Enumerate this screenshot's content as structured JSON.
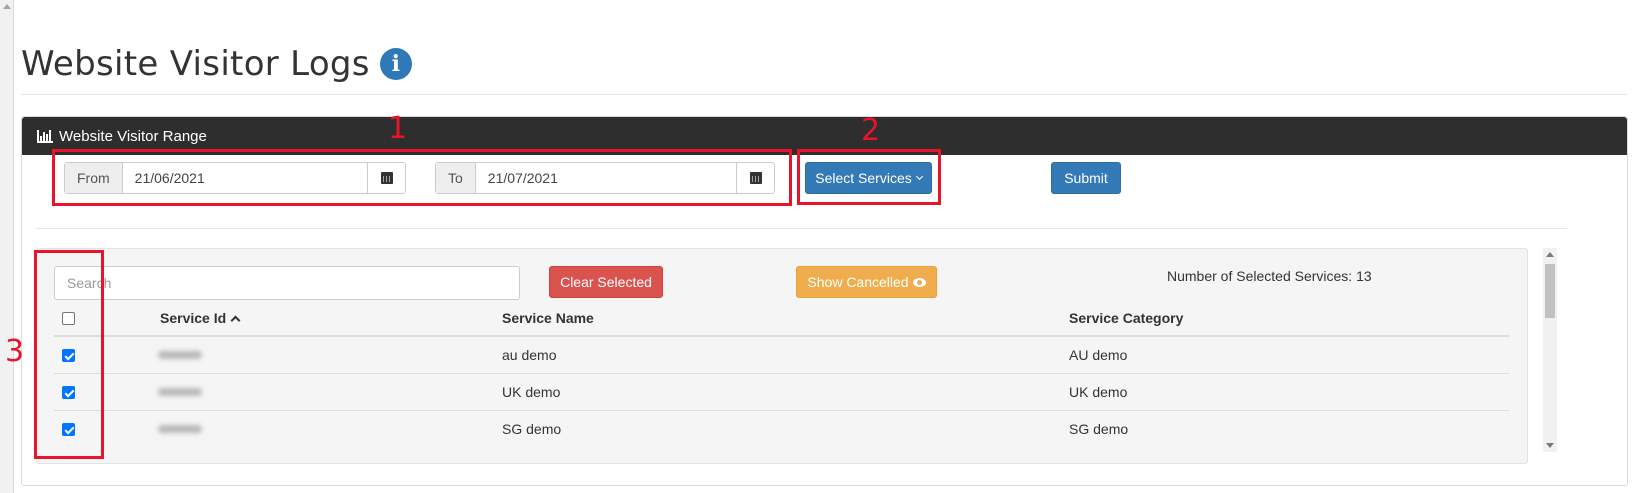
{
  "page": {
    "title": "Website Visitor Logs"
  },
  "panel": {
    "title": "Website Visitor Range"
  },
  "date_range": {
    "from_label": "From",
    "from_value": "21/06/2021",
    "to_label": "To",
    "to_value": "21/07/2021"
  },
  "buttons": {
    "select_services": "Select Services",
    "submit": "Submit",
    "clear_selected": "Clear Selected",
    "show_cancelled": "Show Cancelled"
  },
  "search": {
    "placeholder": "Search"
  },
  "selection": {
    "count_text": "Number of Selected Services: 13"
  },
  "table": {
    "columns": [
      "Service Id",
      "Service Name",
      "Service Category"
    ],
    "rows": [
      {
        "checked": true,
        "name": "au demo",
        "category": "AU demo"
      },
      {
        "checked": true,
        "name": "UK demo",
        "category": "UK demo"
      },
      {
        "checked": true,
        "name": "SG demo",
        "category": "SG demo"
      }
    ]
  },
  "annotations": [
    "1",
    "2",
    "3"
  ],
  "colors": {
    "primary": "#337ab7",
    "danger": "#d9534f",
    "warning": "#f0ad4e",
    "panel_header": "#2e2e2e",
    "annotation": "#e8142b"
  },
  "icons": {
    "title": "info-circle-icon",
    "panel": "bar-chart-icon",
    "date": "calendar-icon",
    "sort": "chevron-up-icon",
    "cancelled": "eye-slash-icon"
  }
}
